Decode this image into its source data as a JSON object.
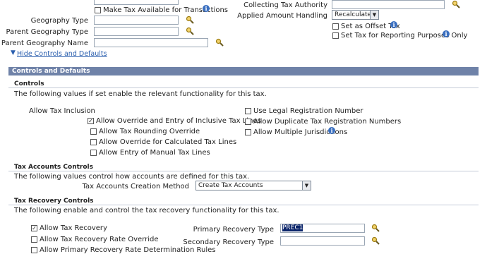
{
  "top": {
    "make_tax_available_label": "Make Tax Available for Transactions",
    "geography_type_label": "Geography Type",
    "parent_geography_type_label": "Parent Geography Type",
    "parent_geography_name_label": "Parent Geography Name",
    "collecting_tax_authority_label": "Collecting Tax Authority",
    "applied_amount_handling_label": "Applied Amount Handling",
    "applied_amount_handling_value": "Recalculated",
    "set_as_offset_tax_label": "Set as Offset Tax",
    "set_tax_for_reporting_label": "Set Tax for Reporting Purposes Only",
    "hide_controls_link": "Hide Controls and Defaults"
  },
  "controls_defaults": {
    "section_title": "Controls and Defaults",
    "controls_heading": "Controls",
    "controls_desc": "The following values if set enable the relevant functionality for this tax.",
    "allow_tax_inclusion_label": "Allow Tax Inclusion",
    "allow_override_inclusive_label": "Allow Override and Entry of Inclusive Tax Lines",
    "allow_rounding_override_label": "Allow Tax Rounding Override",
    "allow_override_calculated_label": "Allow Override for Calculated Tax Lines",
    "allow_manual_tax_lines_label": "Allow Entry of Manual Tax Lines",
    "use_legal_registration_label": "Use Legal Registration Number",
    "allow_duplicate_registration_label": "Allow Duplicate Tax Registration Numbers",
    "allow_multiple_jurisdictions_label": "Allow Multiple Jurisdictions"
  },
  "tax_accounts": {
    "heading": "Tax Accounts Controls",
    "desc": "The following values control how accounts are defined for this tax.",
    "creation_method_label": "Tax Accounts Creation Method",
    "creation_method_value": "Create Tax Accounts"
  },
  "tax_recovery": {
    "heading": "Tax Recovery Controls",
    "desc": "The following enable and control the tax recovery functionality for this tax.",
    "allow_tax_recovery_label": "Allow Tax Recovery",
    "allow_rate_override_label": "Allow Tax Recovery Rate Override",
    "allow_primary_rate_rules_label": "Allow Primary Recovery Rate Determination Rules",
    "primary_recovery_type_label": "Primary Recovery Type",
    "primary_recovery_type_value": "PREC1",
    "secondary_recovery_type_label": "Secondary Recovery Type"
  },
  "checked": {
    "allow_override_inclusive": true,
    "allow_tax_recovery": true
  }
}
